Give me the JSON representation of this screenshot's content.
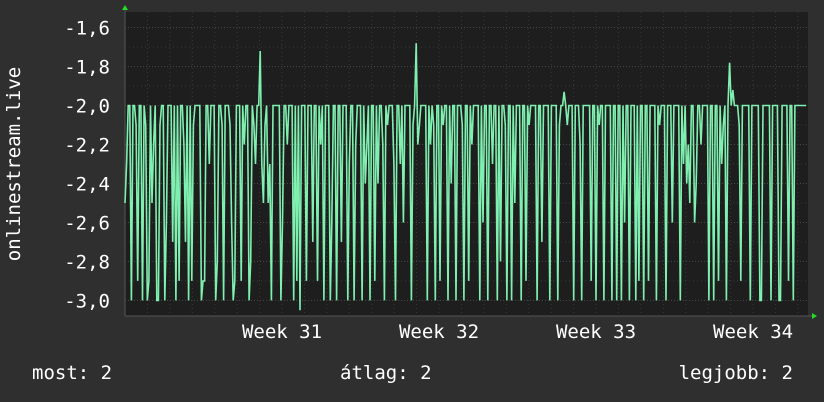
{
  "colors": {
    "background": "#2f2f2f",
    "plot_background": "#1e1e1e",
    "grid": "#4a4a4a",
    "line": "#7ff0b0",
    "arrow": "#22dd22",
    "text": "#ffffff"
  },
  "stats": {
    "now": "most: 2",
    "avg": "átlag: 2",
    "max": "legjobb: 2"
  },
  "chart_data": {
    "type": "line",
    "ylabel": "onlinestream.live",
    "xlabel": "",
    "title": "",
    "x_tick_labels": [
      "Week 31",
      "Week 32",
      "Week 33",
      "Week 34"
    ],
    "x_tick_positions": [
      1.0,
      2.0,
      3.0,
      4.0
    ],
    "xlim": [
      0.0,
      4.35
    ],
    "y_tick_labels": [
      "-1,6",
      "-1,8",
      "-2,0",
      "-2,2",
      "-2,4",
      "-2,6",
      "-2,8",
      "-3,0"
    ],
    "y_ticks": [
      -1.6,
      -1.8,
      -2.0,
      -2.2,
      -2.4,
      -2.6,
      -2.8,
      -3.0
    ],
    "ylim": [
      -3.08,
      -1.52
    ],
    "grid": true,
    "series": [
      {
        "values": [
          -2.5,
          -2.3,
          -2.0,
          -2.0,
          -3.0,
          -2.0,
          -2.0,
          -2.1,
          -2.9,
          -2.0,
          -2.0,
          -3.0,
          -2.0,
          -2.1,
          -3.0,
          -2.9,
          -2.0,
          -2.5,
          -2.2,
          -2.0,
          -3.0,
          -3.0,
          -2.1,
          -2.0,
          -2.0,
          -3.0,
          -2.6,
          -2.0,
          -2.0,
          -2.0,
          -2.7,
          -2.0,
          -3.0,
          -2.0,
          -2.9,
          -2.0,
          -2.0,
          -2.2,
          -2.7,
          -2.0,
          -3.0,
          -2.0,
          -2.9,
          -2.1,
          -2.0,
          -2.0,
          -2.0,
          -2.0,
          -3.0,
          -2.9,
          -2.9,
          -2.0,
          -2.0,
          -2.3,
          -2.0,
          -2.0,
          -2.0,
          -3.0,
          -2.8,
          -2.0,
          -2.0,
          -2.1,
          -3.0,
          -2.0,
          -2.0,
          -2.0,
          -2.1,
          -2.6,
          -3.0,
          -2.9,
          -2.0,
          -2.0,
          -2.0,
          -2.9,
          -2.0,
          -2.2,
          -2.0,
          -2.0,
          -3.0,
          -2.8,
          -2.0,
          -2.1,
          -2.3,
          -2.0,
          -2.0,
          -1.72,
          -2.3,
          -2.5,
          -2.1,
          -2.0,
          -2.5,
          -2.3,
          -3.0,
          -2.0,
          -2.0,
          -2.0,
          -2.0,
          -2.0,
          -3.0,
          -2.6,
          -2.0,
          -2.0,
          -2.2,
          -2.0,
          -2.0,
          -2.0,
          -3.0,
          -2.0,
          -2.9,
          -2.0,
          -3.05,
          -2.0,
          -2.0,
          -2.0,
          -2.9,
          -2.0,
          -2.0,
          -2.0,
          -2.7,
          -2.0,
          -2.0,
          -2.9,
          -2.0,
          -2.2,
          -2.0,
          -3.0,
          -2.0,
          -2.0,
          -2.0,
          -3.0,
          -2.6,
          -2.0,
          -2.0,
          -3.0,
          -2.0,
          -2.0,
          -2.7,
          -2.0,
          -2.0,
          -2.0,
          -3.0,
          -2.3,
          -2.0,
          -2.0,
          -3.0,
          -2.2,
          -2.0,
          -2.0,
          -2.0,
          -3.0,
          -2.0,
          -2.4,
          -2.2,
          -2.0,
          -3.0,
          -2.0,
          -2.0,
          -2.9,
          -2.0,
          -2.4,
          -2.0,
          -2.0,
          -2.2,
          -3.0,
          -2.0,
          -2.1,
          -2.0,
          -2.0,
          -2.0,
          -2.3,
          -3.0,
          -2.0,
          -2.0,
          -2.3,
          -2.0,
          -2.6,
          -2.0,
          -2.0,
          -2.0,
          -2.0,
          -3.0,
          -2.1,
          -2.0,
          -1.68,
          -2.2,
          -2.1,
          -2.0,
          -2.0,
          -2.0,
          -2.0,
          -3.0,
          -2.0,
          -2.2,
          -2.0,
          -2.1,
          -3.0,
          -2.0,
          -2.0,
          -2.9,
          -2.0,
          -2.1,
          -2.0,
          -2.0,
          -3.0,
          -2.0,
          -2.4,
          -2.0,
          -2.0,
          -3.0,
          -2.0,
          -2.0,
          -2.0,
          -2.1,
          -3.0,
          -2.0,
          -2.0,
          -2.9,
          -2.0,
          -2.2,
          -2.0,
          -2.0,
          -2.0,
          -2.0,
          -3.0,
          -2.0,
          -2.6,
          -2.0,
          -2.0,
          -3.0,
          -2.0,
          -2.0,
          -2.3,
          -2.0,
          -2.0,
          -3.0,
          -2.0,
          -2.8,
          -2.0,
          -2.0,
          -2.1,
          -3.0,
          -2.0,
          -2.0,
          -3.0,
          -2.0,
          -2.5,
          -2.0,
          -2.0,
          -2.0,
          -3.0,
          -2.0,
          -2.0,
          -2.9,
          -2.0,
          -2.1,
          -2.0,
          -2.0,
          -2.0,
          -2.0,
          -3.0,
          -2.0,
          -2.0,
          -2.7,
          -2.0,
          -2.0,
          -2.0,
          -2.0,
          -3.0,
          -2.0,
          -2.0,
          -2.0,
          -2.0,
          -3.0,
          -2.1,
          -2.0,
          -2.0,
          -1.93,
          -2.0,
          -2.1,
          -2.0,
          -2.0,
          -2.0,
          -3.0,
          -2.0,
          -2.0,
          -2.0,
          -2.2,
          -3.0,
          -2.0,
          -2.0,
          -2.0,
          -2.0,
          -2.0,
          -2.9,
          -2.0,
          -2.0,
          -3.0,
          -2.0,
          -2.1,
          -2.0,
          -2.0,
          -3.0,
          -2.0,
          -2.0,
          -2.0,
          -2.0,
          -3.0,
          -2.0,
          -2.0,
          -3.0,
          -2.0,
          -2.0,
          -3.0,
          -2.0,
          -2.6,
          -2.0,
          -2.0,
          -3.0,
          -2.0,
          -2.0,
          -2.0,
          -3.0,
          -2.0,
          -2.9,
          -2.0,
          -2.0,
          -3.0,
          -2.0,
          -2.0,
          -2.9,
          -2.0,
          -2.0,
          -2.0,
          -2.0,
          -3.0,
          -2.0,
          -2.1,
          -2.0,
          -2.0,
          -2.0,
          -3.0,
          -2.0,
          -2.0,
          -2.0,
          -2.6,
          -2.0,
          -2.0,
          -2.0,
          -2.0,
          -3.0,
          -2.0,
          -2.3,
          -2.0,
          -2.4,
          -2.2,
          -2.5,
          -2.0,
          -2.0,
          -2.6,
          -2.4,
          -2.0,
          -2.0,
          -2.2,
          -2.0,
          -2.0,
          -2.0,
          -2.0,
          -3.0,
          -2.0,
          -2.0,
          -3.0,
          -2.0,
          -2.0,
          -2.9,
          -2.0,
          -2.3,
          -2.1,
          -2.0,
          -3.0,
          -2.0,
          -1.78,
          -2.0,
          -1.92,
          -2.0,
          -2.0,
          -2.0,
          -2.1,
          -2.9,
          -2.0,
          -2.0,
          -2.0,
          -2.0,
          -2.0,
          -3.0,
          -2.0,
          -2.0,
          -2.0,
          -2.0,
          -2.0,
          -3.0,
          -3.0,
          -2.0,
          -2.0,
          -2.0,
          -2.0,
          -2.0,
          -3.0,
          -2.0,
          -2.0,
          -2.0,
          -2.0,
          -3.0,
          -3.0,
          -2.0,
          -2.0,
          -2.0,
          -2.0,
          -2.9,
          -2.0,
          -2.0,
          -3.0,
          -2.0,
          -2.0,
          -2.0,
          -2.0,
          -2.0,
          -2.0,
          -2.0,
          -2.0
        ]
      }
    ]
  }
}
